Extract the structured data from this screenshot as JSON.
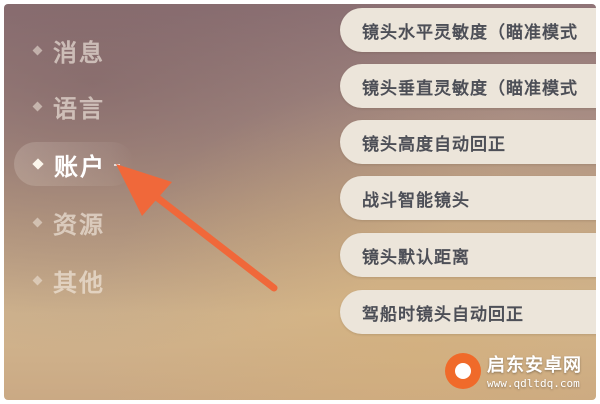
{
  "sidebar": {
    "items": [
      {
        "label": "消息",
        "active": false
      },
      {
        "label": "语言",
        "active": false
      },
      {
        "label": "账户",
        "active": true
      },
      {
        "label": "资源",
        "active": false
      },
      {
        "label": "其他",
        "active": false
      }
    ]
  },
  "settings": {
    "items": [
      {
        "label": "镜头水平灵敏度（瞄准模式"
      },
      {
        "label": "镜头垂直灵敏度（瞄准模式"
      },
      {
        "label": "镜头高度自动回正"
      },
      {
        "label": "战斗智能镜头"
      },
      {
        "label": "镜头默认距离"
      },
      {
        "label": "驾船时镜头自动回正"
      }
    ]
  },
  "annotation": {
    "arrow_color": "#f0683a",
    "target": "账户"
  },
  "watermark": {
    "title": "启东安卓网",
    "url": "www.qdltdq.com",
    "logo_color": "#f06a2a"
  },
  "colors": {
    "setting_bg": "#ece5da",
    "setting_text": "#4d4f57",
    "active_label": "#ffffff"
  }
}
